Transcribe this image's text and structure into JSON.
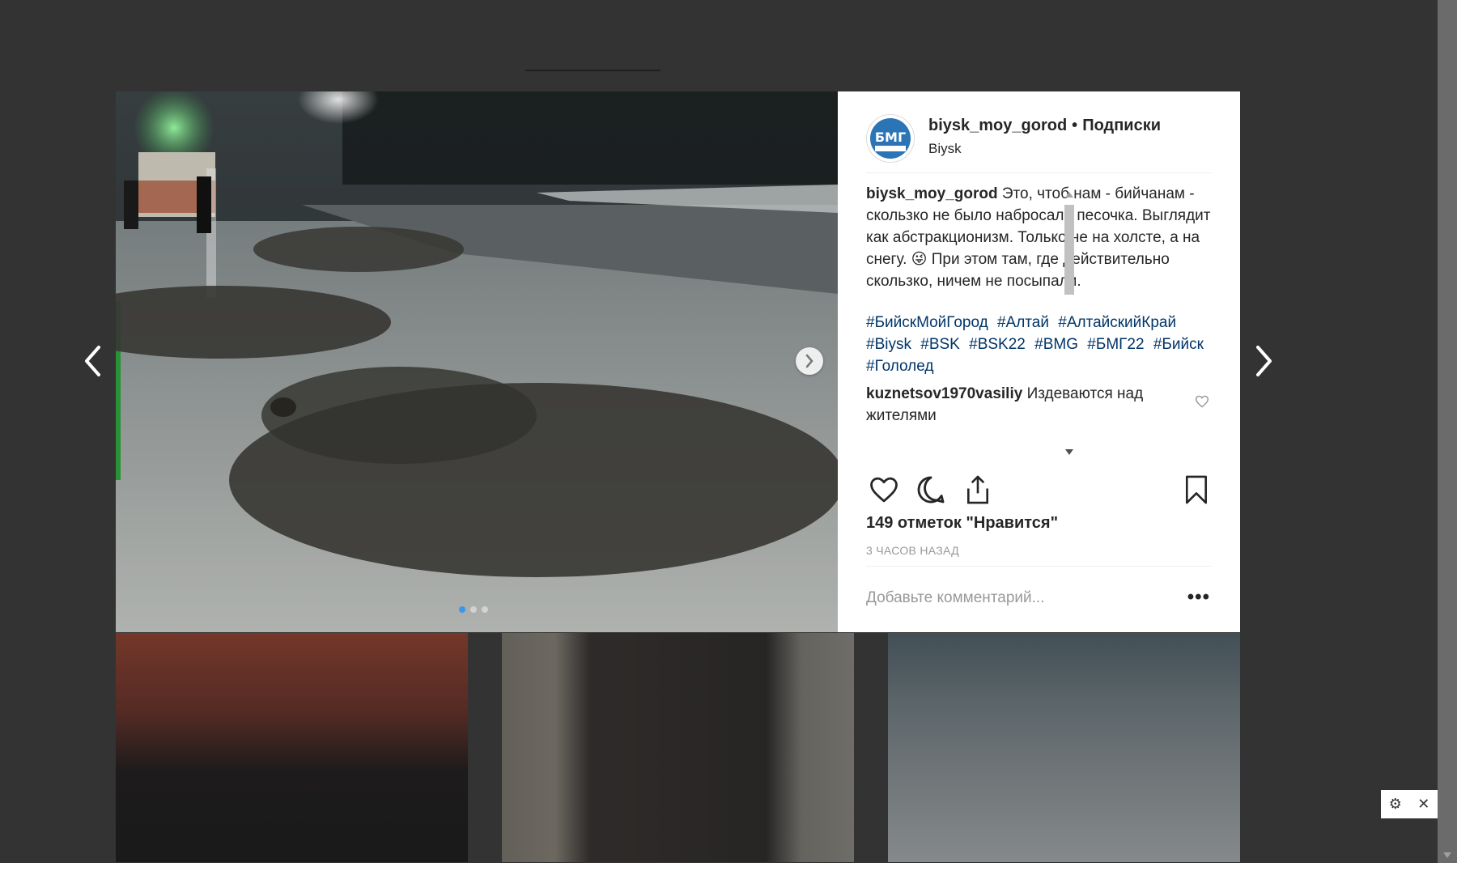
{
  "post": {
    "username": "biysk_moy_gorod",
    "separator": "•",
    "follow_label": "Подписки",
    "location": "Biysk",
    "avatar_text": "БМГ",
    "caption_author": "biysk_moy_gorod",
    "caption_text": "Это, чтоб нам - бийчанам - скользко не было набросали песочка. Выглядит как абстракционизм. Только не на холсте, а на снегу. 😜 При этом там, где действительно скользко, ничем не посыпали.",
    "hashtags": [
      "#БийскМойГород",
      "#Алтай",
      "#АлтайскийКрай",
      "#Biysk",
      "#BSK",
      "#BSK22",
      "#BMG",
      "#БМГ22",
      "#Бийск",
      "#Гололед"
    ],
    "comments": [
      {
        "author": "kuznetsov1970vasiliy",
        "text": "Издеваются над жителями"
      }
    ],
    "likes": "149 отметок \"Нравится\"",
    "time": "3 ЧАСОВ НАЗАД",
    "comment_placeholder": "Добавьте комментарий...",
    "more_label": "•••",
    "carousel_total": 3,
    "carousel_index": 0
  },
  "icons": {
    "like": "heart-icon",
    "comment": "speech-bubble-icon",
    "share": "share-icon",
    "save": "bookmark-icon",
    "prev": "chevron-left-icon",
    "next": "chevron-right-icon"
  },
  "widget": {
    "gear": "⚙",
    "close": "✕"
  },
  "colors": {
    "hashtag": "#003569",
    "text": "#262626",
    "muted": "#999999",
    "overlay": "#333333"
  }
}
